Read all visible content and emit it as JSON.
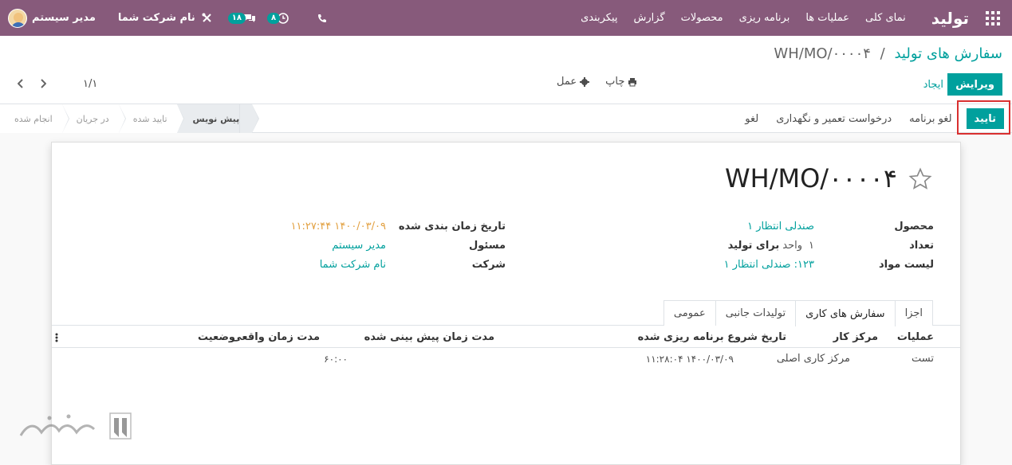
{
  "navbar": {
    "brand": "تولید",
    "menu": [
      "نمای کلی",
      "عملیات ها",
      "برنامه ریزی",
      "محصولات",
      "گزارش",
      "پیکربندی"
    ],
    "activity_count": "۸",
    "messages_count": "۱۸",
    "company": "نام شرکت شما",
    "user": "مدیر سیستم"
  },
  "breadcrumb": {
    "parent": "سفارش های تولید",
    "separator": "/",
    "current": "WH/MO/۰۰۰۰۴"
  },
  "buttons": {
    "edit": "ویرایش",
    "create": "ایجاد"
  },
  "actions": {
    "print": "چاپ",
    "action": "عمل"
  },
  "pager": {
    "value": "۱/۱"
  },
  "statusbar": {
    "confirm": "تایید",
    "cancel_plan": "لغو برنامه",
    "maintenance": "درخواست تعمیر و نگهداری",
    "cancel": "لغو",
    "stages": [
      {
        "label": "پیش نویس",
        "current": true
      },
      {
        "label": "تایید شده",
        "current": false
      },
      {
        "label": "در جریان",
        "current": false
      },
      {
        "label": "انجام شده",
        "current": false
      }
    ]
  },
  "form": {
    "title": "WH/MO/۰۰۰۰۴",
    "product_label": "محصول",
    "product_value": "صندلی انتظار ۱",
    "qty_label": "تعداد",
    "qty_value": "۱",
    "qty_uom": "واحد",
    "qty_suffix": "برای تولید",
    "bom_label": "لیست مواد",
    "bom_value": "۱۲۳: صندلی انتظار ۱",
    "scheduled_label": "تاریخ زمان بندی شده",
    "scheduled_value": "۱۴۰۰/۰۳/۰۹ ۱۱:۲۷:۴۴",
    "responsible_label": "مسئول",
    "responsible_value": "مدیر سیستم",
    "company_label": "شرکت",
    "company_value": "نام شرکت شما"
  },
  "tabs": [
    {
      "label": "اجزا",
      "active": false
    },
    {
      "label": "سفارش های کاری",
      "active": true
    },
    {
      "label": "تولیدات جانبی",
      "active": false
    },
    {
      "label": "عمومی",
      "active": false
    }
  ],
  "workorders": {
    "headers": {
      "operation": "عملیات",
      "workcenter": "مرکز کار",
      "scheduled_start": "تاریخ شروع برنامه ریزی شده",
      "expected_duration": "مدت زمان پیش بینی شده",
      "real_duration": "مدت زمان واقعی",
      "status": "وضعیت"
    },
    "rows": [
      {
        "operation": "تست",
        "workcenter": "مرکز کاری اصلی",
        "scheduled_start": "۱۴۰۰/۰۳/۰۹ ۱۱:۲۸:۰۴",
        "expected_duration": "۶۰:۰۰",
        "real_duration": "",
        "status": ""
      }
    ]
  },
  "colors": {
    "brand": "#875a7b",
    "primary": "#00a09d",
    "highlight": "#d93030",
    "warning": "#e2a040"
  }
}
